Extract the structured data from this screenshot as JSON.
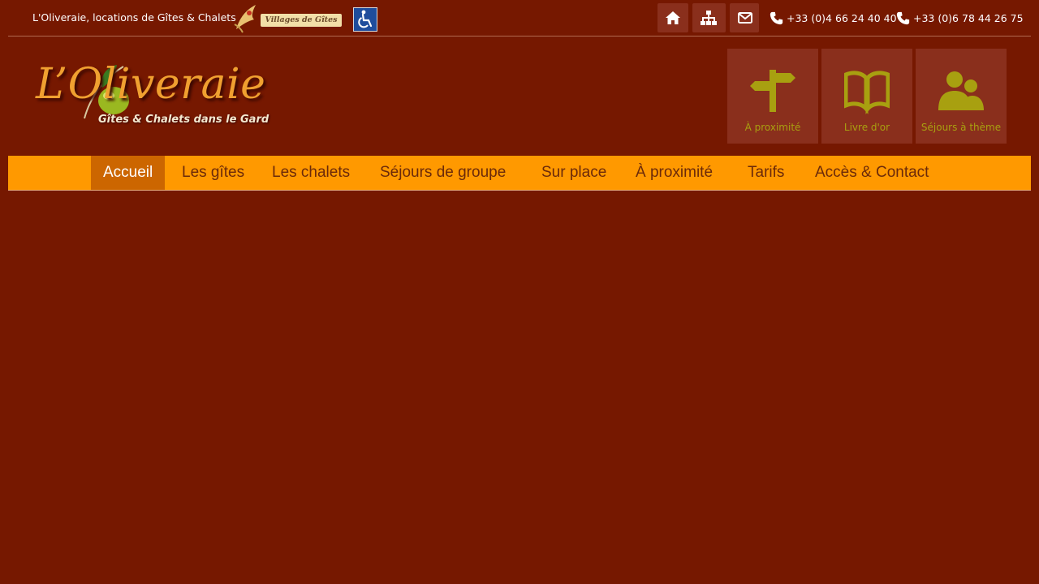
{
  "topbar": {
    "site_name": "L'Oliveraie, locations de Gîtes & Chalets",
    "villages_badge": "Villages de Gîtes",
    "icons": [
      "home-icon",
      "sitemap-icon",
      "envelope-icon",
      "wheelchair-icon"
    ],
    "phone1": "+33 (0)4 66 24 40 40",
    "phone2": "+33 (0)6 78 44 26 75"
  },
  "logo": {
    "title": "L’Oliveraie",
    "subtitle": "Gîtes & Chalets dans le Gard"
  },
  "tiles": [
    {
      "label": "À proximité",
      "icon": "signpost-icon"
    },
    {
      "label": "Livre d'or",
      "icon": "book-icon"
    },
    {
      "label": "Séjours à thème",
      "icon": "users-icon"
    }
  ],
  "nav": {
    "items": [
      {
        "label": "Accueil"
      },
      {
        "label": "Les gîtes"
      },
      {
        "label": "Les chalets"
      },
      {
        "label": "Séjours de groupe"
      },
      {
        "label": "Sur place"
      },
      {
        "label": "À proximité"
      },
      {
        "label": "Tarifs"
      },
      {
        "label": "Accès & Contact"
      }
    ],
    "active_index": 0
  },
  "colors": {
    "background": "#761800",
    "nav_bar": "#ff9900",
    "nav_active": "#cc6600",
    "tile": "#8a2f1c",
    "tile_icon": "#a8a010"
  }
}
